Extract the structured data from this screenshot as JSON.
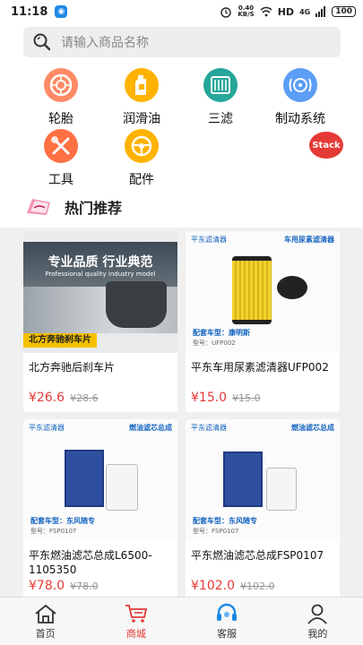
{
  "status": {
    "time": "11:18",
    "speed_top": "0.40",
    "speed_unit": "KB/S",
    "network": "HD",
    "signal": "4G",
    "battery": "100"
  },
  "search": {
    "placeholder": "请输入商品名称"
  },
  "categories": [
    {
      "label": "轮胎",
      "icon": "tire-icon",
      "color": "#ff8a65"
    },
    {
      "label": "润滑油",
      "icon": "oil-bottle-icon",
      "color": "#ffb300"
    },
    {
      "label": "三滤",
      "icon": "filter-icon",
      "color": "#26a69a"
    },
    {
      "label": "制动系统",
      "icon": "brake-icon",
      "color": "#5c9df5"
    },
    {
      "label": "工具",
      "icon": "tools-icon",
      "color": "#ff7043"
    },
    {
      "label": "配件",
      "icon": "steering-wheel-icon",
      "color": "#ffb300"
    }
  ],
  "stack_label": "Stack",
  "hot": {
    "title": "热门推荐"
  },
  "products": [
    {
      "name": "北方奔驰后刹车片",
      "price": "¥26.6",
      "old_price": "¥28.6",
      "banner": "专业品质 行业典范",
      "banner_sub": "Professional quality industry model",
      "caption": "北方奔驰刹车片"
    },
    {
      "name": "平东车用尿素滤清器UFP002",
      "price": "¥15.0",
      "old_price": "¥15.0",
      "brand": "平东滤清器",
      "tag": "车用尿素滤清器",
      "model_label": "配套车型：",
      "model": "康明斯",
      "part": "型号：UFP002"
    },
    {
      "name": "平东燃油滤芯总成L6500-1105350",
      "price": "¥78.0",
      "old_price": "¥78.0",
      "brand": "平东滤清器",
      "tag": "燃油滤芯总成",
      "model_label": "配套车型：",
      "model": "东风随专",
      "part": "型号：FSP0107"
    },
    {
      "name": "平东燃油滤芯总成FSP0107",
      "price": "¥102.0",
      "old_price": "¥102.0",
      "brand": "平东滤清器",
      "tag": "燃油滤芯总成",
      "model_label": "配套车型：",
      "model": "东风随专",
      "part": "型号：FSP0107"
    }
  ],
  "tabs": [
    {
      "label": "首页",
      "icon": "home-icon"
    },
    {
      "label": "商城",
      "icon": "cart-icon"
    },
    {
      "label": "客服",
      "icon": "headset-icon"
    },
    {
      "label": "我的",
      "icon": "user-icon"
    }
  ],
  "colors": {
    "accent": "#e53935",
    "link": "#1565c0"
  }
}
